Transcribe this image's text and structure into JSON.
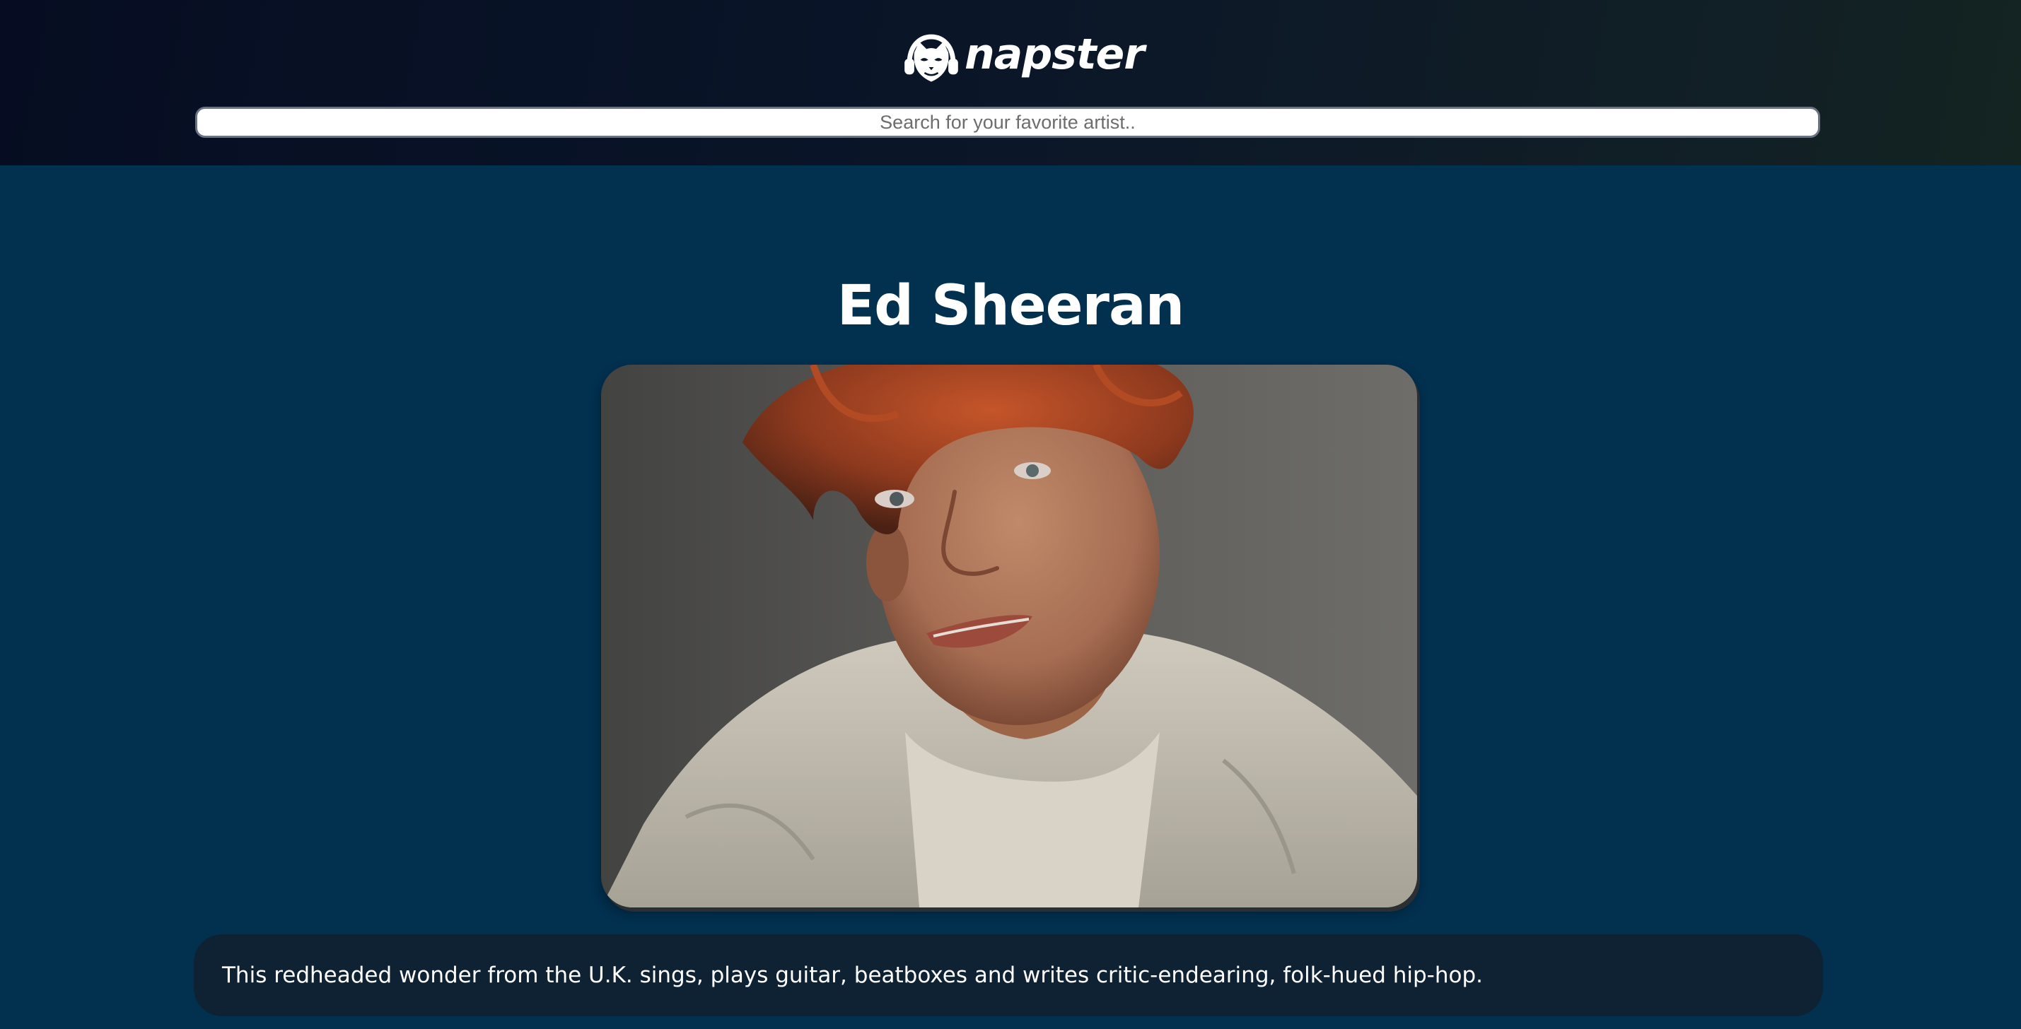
{
  "header": {
    "logo_text": "napster",
    "logo_icon": "napster-cat-headphones-icon"
  },
  "search": {
    "placeholder": "Search for your favorite artist..",
    "value": ""
  },
  "artist": {
    "name": "Ed Sheeran",
    "bio": "This redheaded wonder from the U.K. sings, plays guitar, beatboxes and writes critic-endearing, folk-hued hip-hop."
  },
  "colors": {
    "page_background": "#02304f",
    "header_background": "#0a1528",
    "bio_background": "#0f2234",
    "text": "#ffffff"
  }
}
